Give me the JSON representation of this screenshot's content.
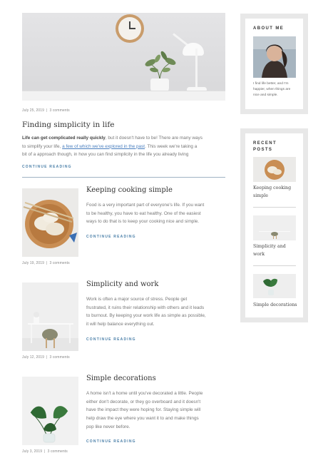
{
  "featured": {
    "date": "July 25, 2019",
    "comments": "3 comments",
    "title": "Finding simplicity in life",
    "lead_bold": "Life can get complicated really quickly",
    "lead_rest": ", but it doesn't have to be! There are many ways",
    "line2_pre": "to simplify your life, ",
    "line2_link": "a few of which we've explored in the past",
    "line2_post": ". This week we're taking a",
    "line3": "bit of a approach though, in how you can find simplicity in the life you already living",
    "continue": "CONTINUE READING"
  },
  "posts": [
    {
      "title": "Keeping cooking simple",
      "lines": [
        "Food is a very important part of everyone's life. If you want",
        "to be healthy, you have to eat healthy. One of the easiest",
        "ways to do that is to keep your cooking nice and simple."
      ],
      "continue": "CONTINUE READING",
      "date": "July 19, 2019",
      "comments": "3 comments"
    },
    {
      "title": "Simplicity and work",
      "lines": [
        "Work is often a major source of stress. People get",
        "frustrated, it ruins their relationship with others and it leads",
        "to burnout. By keeping your work life as simple as possible,",
        "it will help balance everything out."
      ],
      "continue": "CONTINUE READING",
      "date": "July 12, 2019",
      "comments": "3 comments"
    },
    {
      "title": "Simple decorations",
      "lines": [
        "A home isn't a home until you've decorated a little. People",
        "either don't decorate, or they go overboard and it doesn't",
        "have the impact they were hoping for. Staying simple will",
        "help draw the eye where you want it to and make things",
        "pop like never before."
      ],
      "continue": "CONTINUE READING",
      "date": "July 3, 2019",
      "comments": "3 comments"
    }
  ],
  "sidebar": {
    "about": {
      "title": "ABOUT ME",
      "lines": [
        "I find life better, and I'm",
        "happier, when things are",
        "nice and simple."
      ]
    },
    "recent": {
      "title_line1": "RECENT",
      "title_line2": "POSTS",
      "items": [
        {
          "line1": "Keeping cooking",
          "line2": "simple"
        },
        {
          "line1": "Simplicity and",
          "line2": "work"
        },
        {
          "line1": "Simple decorations",
          "line2": ""
        }
      ]
    }
  },
  "colors": {
    "accent_link": "#4a7fbf",
    "continue": "#4a7fa8",
    "sidebar_frame": "#e8e8e8"
  }
}
